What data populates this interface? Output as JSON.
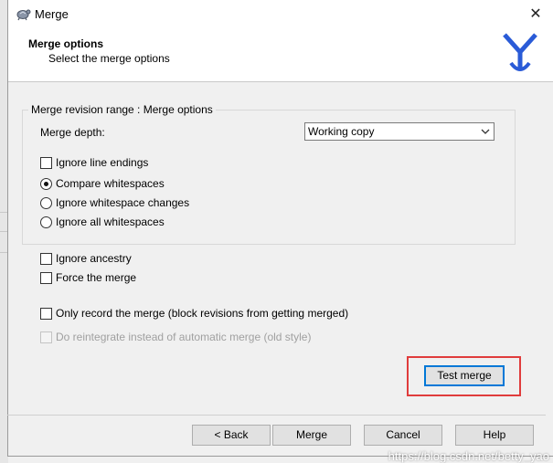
{
  "window": {
    "title": "Merge",
    "close_glyph": "✕"
  },
  "header": {
    "title": "Merge options",
    "subtitle": "Select the merge options"
  },
  "group": {
    "legend": "Merge revision range : Merge options",
    "depth_label": "Merge depth:",
    "depth_value": "Working copy"
  },
  "options": {
    "ignore_line_endings": "Ignore line endings",
    "compare_whitespaces": "Compare whitespaces",
    "ignore_whitespace_changes": "Ignore whitespace changes",
    "ignore_all_whitespaces": "Ignore all whitespaces",
    "ignore_ancestry": "Ignore ancestry",
    "force_merge": "Force the merge",
    "only_record": "Only record the merge (block revisions from getting merged)",
    "do_reintegrate": "Do reintegrate instead of automatic merge (old style)"
  },
  "buttons": {
    "test_merge": "Test merge",
    "back": "< Back",
    "merge": "Merge",
    "cancel": "Cancel",
    "help": "Help"
  },
  "watermark": "https://blog.csdn.net/betty_yao",
  "colors": {
    "highlight": "#e03c3c",
    "focus": "#0078d7",
    "logo": "#2a5bd7"
  }
}
